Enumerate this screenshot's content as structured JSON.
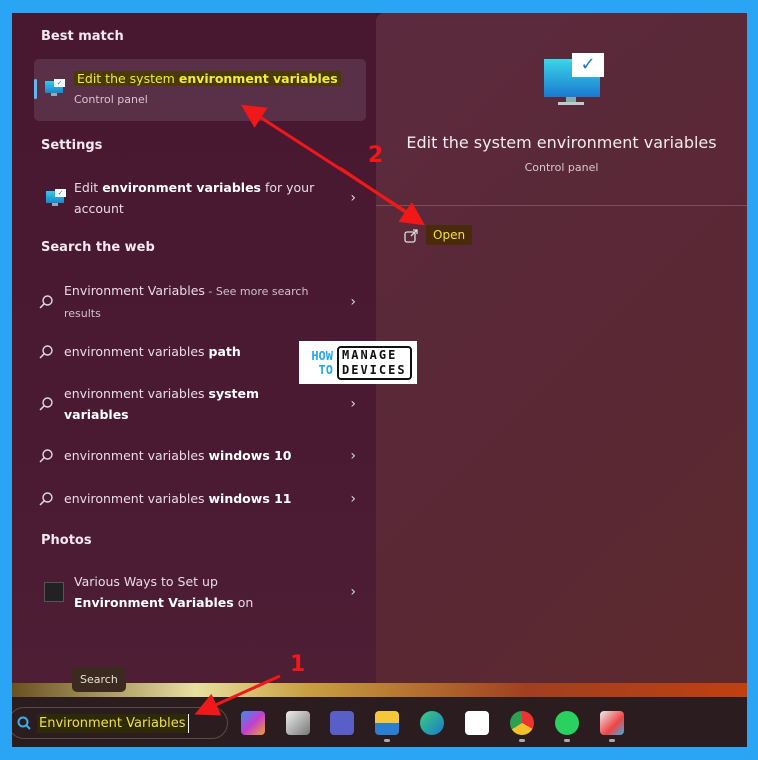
{
  "left": {
    "best_match_header": "Best match",
    "best_match": {
      "title_normal": "Edit the system ",
      "title_bold": "environment variables",
      "subtitle": "Control panel"
    },
    "settings_header": "Settings",
    "settings_item": {
      "pre": "Edit ",
      "bold": "environment variables",
      "post": " for your account"
    },
    "web_header": "Search the web",
    "web_items": [
      {
        "normal": "Environment Variables",
        "bold": "",
        "suffix": " - See more search results"
      },
      {
        "normal": "environment variables ",
        "bold": "path",
        "suffix": ""
      },
      {
        "normal": "environment variables ",
        "bold": "system variables",
        "suffix": ""
      },
      {
        "normal": "environment variables ",
        "bold": "windows 10",
        "suffix": ""
      },
      {
        "normal": "environment variables ",
        "bold": "windows 11",
        "suffix": ""
      }
    ],
    "photos_header": "Photos",
    "photo_item": {
      "normal": "Various Ways to Set up ",
      "bold": "Environment Variables",
      "post": " on"
    }
  },
  "right": {
    "title": "Edit the system environment variables",
    "subtitle": "Control panel",
    "open_label": "Open"
  },
  "watermark": {
    "how": "HOW",
    "to": "TO",
    "manage": "MANAGE",
    "devices": "DEVICES"
  },
  "taskbar": {
    "search_value": "Environment Variables",
    "tooltip": "Search",
    "apps": [
      "copilot-icon",
      "task-view-icon",
      "teams-icon",
      "file-explorer-icon",
      "edge-icon",
      "store-icon",
      "chrome-icon",
      "whatsapp-icon",
      "snipping-tool-icon"
    ]
  },
  "annotations": {
    "step1": "1",
    "step2": "2"
  },
  "colors": {
    "frame": "#2aa4f4",
    "highlight": "#f3ea3a",
    "arrow": "#f01818"
  }
}
